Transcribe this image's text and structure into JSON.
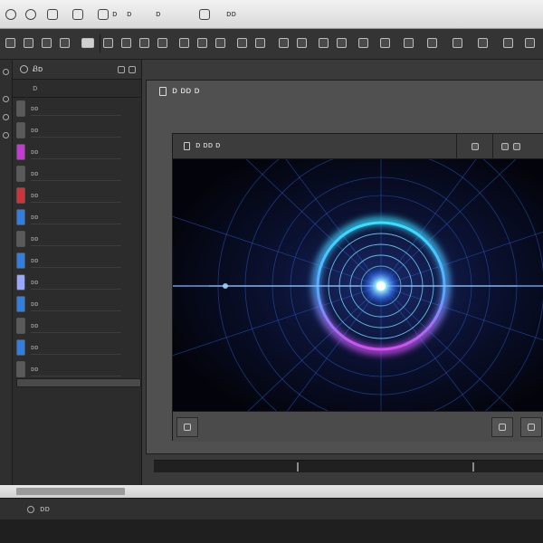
{
  "app": {
    "menu": {
      "items": [
        {
          "icon": "app-logo-icon",
          "label": ""
        },
        {
          "icon": "help-icon",
          "label": ""
        },
        {
          "icon": "window-icon",
          "label": ""
        },
        {
          "icon": "grid-icon",
          "label": ""
        },
        {
          "icon": "tools-icon",
          "label": ""
        },
        {
          "icon": "",
          "label": "ᴅ"
        },
        {
          "icon": "",
          "label": "ᴅ"
        },
        {
          "icon": "",
          "label": "ᴅ"
        },
        {
          "icon": "",
          "label": "ᴅ"
        },
        {
          "icon": "",
          "label": "ᴅᴅ"
        },
        {
          "icon": "",
          "label": ""
        },
        {
          "icon": "",
          "label": ""
        }
      ]
    },
    "colors": {
      "viewport_bg": "#05060f",
      "ring_cyan": "#3fd8ff",
      "ring_magenta": "#c04ef0",
      "grid_blue": "#2c5fd0"
    }
  },
  "sidebar": {
    "header": "Ᏸᴅ",
    "sub": "ᴅ",
    "items": [
      {
        "label": "ᴅᴅ",
        "color": "#5a5a5a"
      },
      {
        "label": "ᴅᴅ",
        "color": "#5a5a5a"
      },
      {
        "label": "ᴅᴅ",
        "color": "#c43ad2"
      },
      {
        "label": "ᴅᴅ",
        "color": "#5a5a5a"
      },
      {
        "label": "ᴅᴅ",
        "color": "#d0323a"
      },
      {
        "label": "ᴅᴅ",
        "color": "#2f7fe0"
      },
      {
        "label": "ᴅᴅ",
        "color": "#5a5a5a"
      },
      {
        "label": "ᴅᴅ",
        "color": "#2f7fe0"
      },
      {
        "label": "ᴅᴅ",
        "color": "#9aa7ff"
      },
      {
        "label": "ᴅᴅ",
        "color": "#2f7fe0"
      },
      {
        "label": "ᴅᴅ",
        "color": "#5a5a5a"
      },
      {
        "label": "ᴅᴅ",
        "color": "#2f7fe0"
      },
      {
        "label": "ᴅᴅ",
        "color": "#5a5a5a"
      }
    ]
  },
  "main": {
    "outer_title": "ᴅ ᴅᴅ ᴅ",
    "panel_title": "ᴅ ᴅᴅ ᴅ"
  },
  "bottom": {
    "status": "ᴅᴅ"
  }
}
